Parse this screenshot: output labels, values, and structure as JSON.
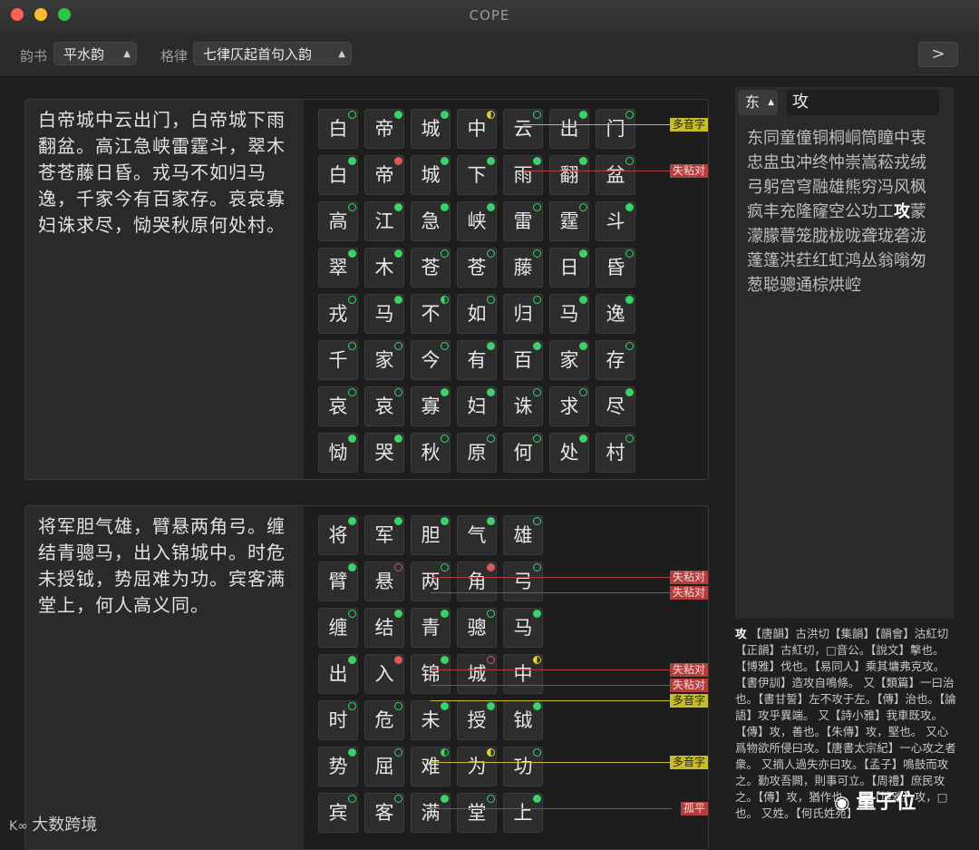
{
  "window": {
    "title": "COPE"
  },
  "toolbar": {
    "rhyme_book_label": "韵书",
    "rhyme_book_value": "平水韵",
    "meter_label": "格律",
    "meter_value": "七律仄起首句入韵",
    "next_label": ">"
  },
  "poems": [
    {
      "text": "白帝城中云出门，白帝城下雨翻盆。高江急峡雷霆斗，翠木苍苍藤日昏。戎马不如归马逸，千家今有百家存。哀哀寡妇诛求尽，恸哭秋原何处村。",
      "rows": [
        [
          "白",
          "帝",
          "城",
          "中",
          "云",
          "出",
          "门"
        ],
        [
          "白",
          "帝",
          "城",
          "下",
          "雨",
          "翻",
          "盆"
        ],
        [
          "高",
          "江",
          "急",
          "峡",
          "雷",
          "霆",
          "斗"
        ],
        [
          "翠",
          "木",
          "苍",
          "苍",
          "藤",
          "日",
          "昏"
        ],
        [
          "戎",
          "马",
          "不",
          "如",
          "归",
          "马",
          "逸"
        ],
        [
          "千",
          "家",
          "今",
          "有",
          "百",
          "家",
          "存"
        ],
        [
          "哀",
          "哀",
          "寡",
          "妇",
          "诛",
          "求",
          "尽"
        ],
        [
          "恸",
          "哭",
          "秋",
          "原",
          "何",
          "处",
          "村"
        ]
      ],
      "tones": [
        [
          "go",
          "g",
          "g",
          "y",
          "go",
          "g",
          "go"
        ],
        [
          "g",
          "r",
          "g",
          "g",
          "g",
          "g",
          "go"
        ],
        [
          "go",
          "g",
          "g",
          "g",
          "go",
          "go",
          "g"
        ],
        [
          "g",
          "g",
          "go",
          "go",
          "go",
          "g",
          "go"
        ],
        [
          "go",
          "g",
          "gh",
          "go",
          "go",
          "g",
          "g"
        ],
        [
          "go",
          "go",
          "go",
          "g",
          "g",
          "g",
          "go"
        ],
        [
          "go",
          "go",
          "g",
          "g",
          "go",
          "go",
          "g"
        ],
        [
          "g",
          "g",
          "go",
          "go",
          "go",
          "g",
          "go"
        ]
      ],
      "notes": [
        {
          "row": 0,
          "text": "多音字",
          "kind": "y"
        },
        {
          "row": 1,
          "text": "失粘对",
          "kind": "r"
        }
      ]
    },
    {
      "text": "将军胆气雄，臂悬两角弓。缠结青骢马，出入锦城中。时危未授钺，势屈难为功。宾客满堂上，何人高义同。",
      "rows": [
        [
          "将",
          "军",
          "胆",
          "气",
          "雄"
        ],
        [
          "臂",
          "悬",
          "两",
          "角",
          "弓"
        ],
        [
          "缠",
          "结",
          "青",
          "骢",
          "马"
        ],
        [
          "出",
          "入",
          "锦",
          "城",
          "中"
        ],
        [
          "时",
          "危",
          "未",
          "授",
          "钺"
        ],
        [
          "势",
          "屈",
          "难",
          "为",
          "功"
        ],
        [
          "宾",
          "客",
          "满",
          "堂",
          "上"
        ]
      ],
      "tones": [
        [
          "g",
          "g",
          "g",
          "g",
          "go"
        ],
        [
          "g",
          "ro",
          "go",
          "r",
          "go"
        ],
        [
          "go",
          "g",
          "g",
          "go",
          "g"
        ],
        [
          "g",
          "r",
          "g",
          "ro",
          "y"
        ],
        [
          "go",
          "go",
          "g",
          "g",
          "g"
        ],
        [
          "g",
          "go",
          "gh",
          "y",
          "go"
        ],
        [
          "go",
          "go",
          "g",
          "go",
          "g"
        ]
      ],
      "notes": [
        {
          "row": 1,
          "text": "失粘对",
          "kind": "r"
        },
        {
          "row": 1,
          "text": "失粘对",
          "kind": "r"
        },
        {
          "row": 3,
          "text": "失粘对",
          "kind": "r"
        },
        {
          "row": 3,
          "text": "失粘对",
          "kind": "r"
        },
        {
          "row": 3,
          "text": "多音字",
          "kind": "y"
        },
        {
          "row": 5,
          "text": "多音字",
          "kind": "y"
        },
        {
          "row": 6,
          "text": "孤平",
          "kind": "r"
        }
      ]
    }
  ],
  "sidebar": {
    "rhyme_group": "东",
    "query": "攻",
    "rhyme_chars_before": "东同童僮铜桐峒筒瞳中衷忠盅虫冲终忡崇嵩菘戎绒弓躬宫穹融雄熊穷冯风枫疯丰充隆窿空公功工",
    "highlight": "攻",
    "rhyme_chars_after": "蒙濛朦瞢笼胧栊咙聋珑砻泷蓬篷洪荭红虹鸿丛翁嗡匆葱聪骢通棕烘崆"
  },
  "dictionary": {
    "head": "攻",
    "body": "【唐韻】古洪切【集韻】【韻會】沽紅切【正韻】古紅切，□音公。【說文】擊也。【博雅】伐也。【易同人】乘其墉弗克攻。【書伊訓】造攻自鳴條。 又【類篇】一曰治也。【書甘誓】左不攻于左。【傳】治也。【論語】攻乎異端。 又【詩小雅】我車既攻。【傳】攻，善也。【朱傳】攻，堅也。 又心爲物欲所侵曰攻。【唐書太宗紀】一心攻之者衆。 又摘人過失亦曰攻。【孟子】鳴鼓而攻之。勤攻吾闕，則事可立。【周禮】庶民攻之。【傳】攻，猶作也。 又【博雅】攻，□也。 又姓。【何氏姓苑】"
  },
  "watermarks": {
    "left": "大数跨境",
    "right": "量子位"
  },
  "colors": {
    "accent_green": "#3bd26a",
    "error_red": "#e05757",
    "warn_yellow": "#e2d23a"
  }
}
